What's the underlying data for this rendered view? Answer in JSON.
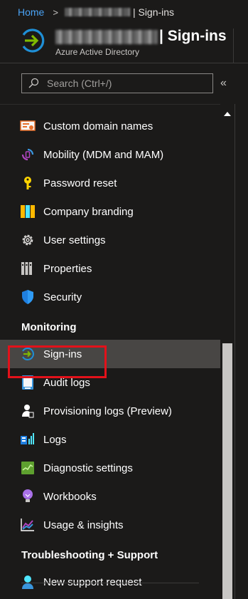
{
  "breadcrumb": {
    "home": "Home",
    "separator": ">",
    "current": "| Sign-ins"
  },
  "header": {
    "title": "| Sign-ins",
    "subtitle": "Azure Active Directory"
  },
  "search": {
    "placeholder": "Search (Ctrl+/)",
    "collapse": "«"
  },
  "menu": {
    "items_top": [
      {
        "label": "Custom domain names",
        "icon": "certificate-icon"
      },
      {
        "label": "Mobility (MDM and MAM)",
        "icon": "mobility-icon"
      },
      {
        "label": "Password reset",
        "icon": "key-icon"
      },
      {
        "label": "Company branding",
        "icon": "branding-icon"
      },
      {
        "label": "User settings",
        "icon": "gear-icon"
      },
      {
        "label": "Properties",
        "icon": "properties-icon"
      },
      {
        "label": "Security",
        "icon": "shield-icon"
      }
    ],
    "monitoring_header": "Monitoring",
    "items_monitoring": [
      {
        "label": "Sign-ins",
        "icon": "signin-arrow-icon",
        "active": true
      },
      {
        "label": "Audit logs",
        "icon": "audit-log-icon"
      },
      {
        "label": "Provisioning logs (Preview)",
        "icon": "provisioning-icon"
      },
      {
        "label": "Logs",
        "icon": "logs-icon"
      },
      {
        "label": "Diagnostic settings",
        "icon": "diagnostic-icon"
      },
      {
        "label": "Workbooks",
        "icon": "lightbulb-icon"
      },
      {
        "label": "Usage & insights",
        "icon": "insights-chart-icon"
      }
    ],
    "support_header": "Troubleshooting + Support",
    "items_support": [
      {
        "label": "New support request",
        "icon": "support-person-icon"
      }
    ]
  },
  "colors": {
    "accent_link": "#4aa3f5",
    "highlight": "#e3111a",
    "active_bg": "#484644"
  }
}
